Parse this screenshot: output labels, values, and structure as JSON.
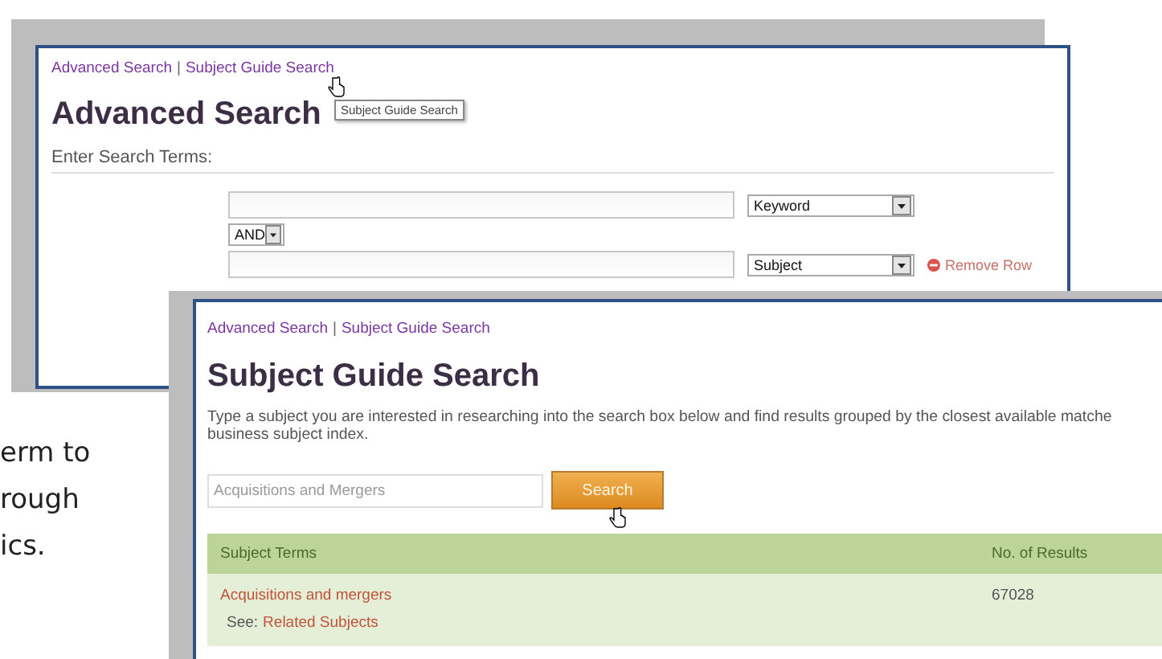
{
  "document_text": [
    "erm to",
    "rough",
    "ics."
  ],
  "advanced_search": {
    "breadcrumbs": [
      {
        "label": "Advanced Search"
      },
      {
        "label": "Subject Guide Search"
      }
    ],
    "separator": "|",
    "tooltip": "Subject Guide Search",
    "title": "Advanced Search",
    "section_label": "Enter Search Terms:",
    "operator": "AND",
    "search_rows": [
      {
        "field": "Keyword"
      },
      {
        "field": "Subject",
        "remove_label": "Remove Row"
      }
    ]
  },
  "subject_guide_search": {
    "breadcrumbs": [
      {
        "label": "Advanced Search"
      },
      {
        "label": "Subject Guide Search"
      }
    ],
    "separator": "|",
    "title": "Subject Guide Search",
    "description_lines": [
      "Type a subject you are interested in researching into the search box below and find results grouped by the closest available matche",
      "business subject index."
    ],
    "search_value": "Acquisitions and Mergers",
    "search_button": "Search",
    "table": {
      "columns": [
        "Subject Terms",
        "No. of Results"
      ],
      "rows": [
        {
          "term": "Acquisitions and mergers",
          "see_label": "See:",
          "see_link": "Related Subjects",
          "count": "67028"
        }
      ]
    }
  }
}
